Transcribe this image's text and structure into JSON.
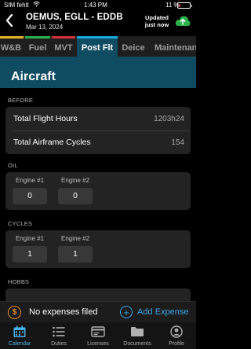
{
  "status_bar": {
    "carrier": "SIM fehlt",
    "time": "1:43 PM",
    "battery": "11 %"
  },
  "header": {
    "title": "OEMUS, EGLL - EDDB",
    "date": "Mar 13, 2024",
    "updated": "Updated just now"
  },
  "tabs": [
    {
      "label": "W&B",
      "color": "#e2b128"
    },
    {
      "label": "Fuel",
      "color": "#2bb04a"
    },
    {
      "label": "MVT",
      "color": "#d1343a"
    },
    {
      "label": "Post Flt",
      "color": "#18aadc",
      "active": true
    },
    {
      "label": "Deice"
    },
    {
      "label": "Maintenance"
    }
  ],
  "section_title": "Aircraft",
  "before": {
    "label": "BEFORE",
    "rows": [
      {
        "label": "Total Flight Hours",
        "value": "1203h24"
      },
      {
        "label": "Total Airframe Cycles",
        "value": "154"
      }
    ]
  },
  "oil": {
    "label": "OIL",
    "engines": [
      {
        "label": "Engine #1",
        "value": "0"
      },
      {
        "label": "Engine #2",
        "value": "0"
      }
    ]
  },
  "cycles": {
    "label": "CYCLES",
    "engines": [
      {
        "label": "Engine #1",
        "value": "1"
      },
      {
        "label": "Engine #2",
        "value": "1"
      }
    ]
  },
  "hobbs": {
    "label": "HOBBS"
  },
  "expenses": {
    "empty_text": "No expenses filed",
    "add_label": "Add Expense"
  },
  "nav": [
    {
      "label": "Calendar",
      "icon": "calendar-icon",
      "active": true
    },
    {
      "label": "Duties",
      "icon": "list-icon"
    },
    {
      "label": "Licenses",
      "icon": "license-icon"
    },
    {
      "label": "Documents",
      "icon": "folder-icon"
    },
    {
      "label": "Profile",
      "icon": "profile-icon"
    }
  ],
  "colors": {
    "accent": "#18aadc",
    "banner": "#0f4b61",
    "link": "#3aa6e4",
    "expense": "#d8902a"
  }
}
